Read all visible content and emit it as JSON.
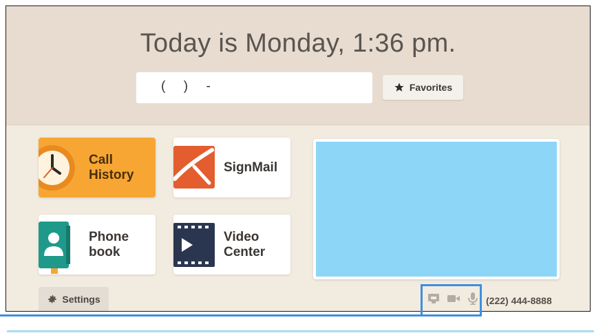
{
  "header": {
    "title": "Today is Monday, 1:36 pm."
  },
  "dial": {
    "value": "(     )     -"
  },
  "favorites": {
    "label": "Favorites",
    "icon": "star-icon"
  },
  "tiles": [
    {
      "label": "Call History",
      "icon": "clock-icon",
      "state": "selected",
      "color": "#f7a634"
    },
    {
      "label": "SignMail",
      "icon": "signmail-icon",
      "color": "#e35d2f"
    },
    {
      "label": "Phone book",
      "icon": "contact-book-icon",
      "color": "#1f9a8a"
    },
    {
      "label": "Video Center",
      "icon": "film-play-icon",
      "color": "#2a3650"
    }
  ],
  "settings": {
    "label": "Settings",
    "icon": "gear-icon"
  },
  "status": {
    "icons": [
      "network-icon",
      "camera-icon",
      "microphone-icon"
    ],
    "phone_number": "(222) 444-8888"
  },
  "colors": {
    "header_bg": "#e8dcd0",
    "body_bg": "#f2ebe0",
    "preview_bg": "#8dd6f8",
    "highlight": "#3d8ee0"
  }
}
